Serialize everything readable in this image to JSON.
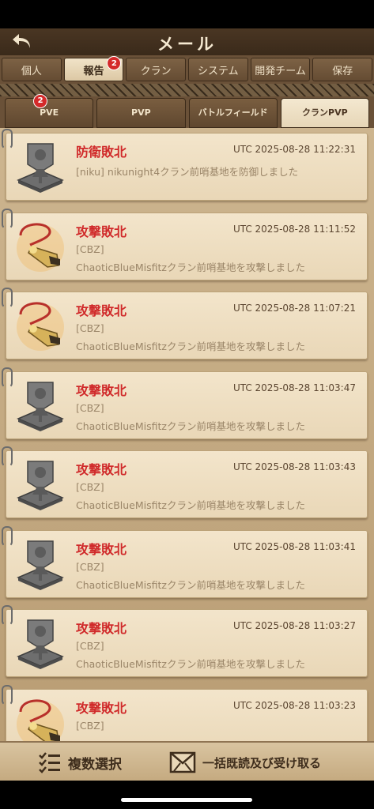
{
  "header": {
    "title": "メール"
  },
  "main_tabs": [
    {
      "label": "個人",
      "active": false,
      "badge": ""
    },
    {
      "label": "報告",
      "active": true,
      "badge": "2"
    },
    {
      "label": "クラン",
      "active": false,
      "badge": ""
    },
    {
      "label": "システム",
      "active": false,
      "badge": ""
    },
    {
      "label": "開発チーム",
      "active": false,
      "badge": ""
    },
    {
      "label": "保存",
      "active": false,
      "badge": ""
    }
  ],
  "sub_tabs": [
    {
      "label": "PVE",
      "active": false,
      "badge": "2"
    },
    {
      "label": "PVP",
      "active": false,
      "badge": ""
    },
    {
      "label": "バトルフィールド",
      "active": false,
      "badge": ""
    },
    {
      "label": "クランPVP",
      "active": true,
      "badge": ""
    }
  ],
  "reports": [
    {
      "title": "防衛敗北",
      "time": "UTC 2025-08-28 11:22:31",
      "line1": "[niku] nikunight4クラン前哨基地を防御しました",
      "line2": "",
      "icon": "banner-icon"
    },
    {
      "title": "攻撃敗北",
      "time": "UTC 2025-08-28 11:11:52",
      "line1": "[CBZ]",
      "line2": "ChaoticBlueMisfitzクラン前哨基地を攻撃しました",
      "icon": "whistle-icon"
    },
    {
      "title": "攻撃敗北",
      "time": "UTC 2025-08-28 11:07:21",
      "line1": "[CBZ]",
      "line2": "ChaoticBlueMisfitzクラン前哨基地を攻撃しました",
      "icon": "whistle-icon"
    },
    {
      "title": "攻撃敗北",
      "time": "UTC 2025-08-28 11:03:47",
      "line1": "[CBZ]",
      "line2": "ChaoticBlueMisfitzクラン前哨基地を攻撃しました",
      "icon": "banner-icon"
    },
    {
      "title": "攻撃敗北",
      "time": "UTC 2025-08-28 11:03:43",
      "line1": "[CBZ]",
      "line2": "ChaoticBlueMisfitzクラン前哨基地を攻撃しました",
      "icon": "banner-icon"
    },
    {
      "title": "攻撃敗北",
      "time": "UTC 2025-08-28 11:03:41",
      "line1": "[CBZ]",
      "line2": "ChaoticBlueMisfitzクラン前哨基地を攻撃しました",
      "icon": "banner-icon"
    },
    {
      "title": "攻撃敗北",
      "time": "UTC 2025-08-28 11:03:27",
      "line1": "[CBZ]",
      "line2": "ChaoticBlueMisfitzクラン前哨基地を攻撃しました",
      "icon": "banner-icon"
    },
    {
      "title": "攻撃敗北",
      "time": "UTC 2025-08-28 11:03:23",
      "line1": "[CBZ]",
      "line2": "",
      "icon": "whistle-icon"
    }
  ],
  "bottom": {
    "multi_select": "複数選択",
    "read_all": "一括既読及び受け取る"
  },
  "colors": {
    "accent_red": "#d02a2a",
    "panel": "#f3e5cb",
    "brown": "#5b4630"
  }
}
